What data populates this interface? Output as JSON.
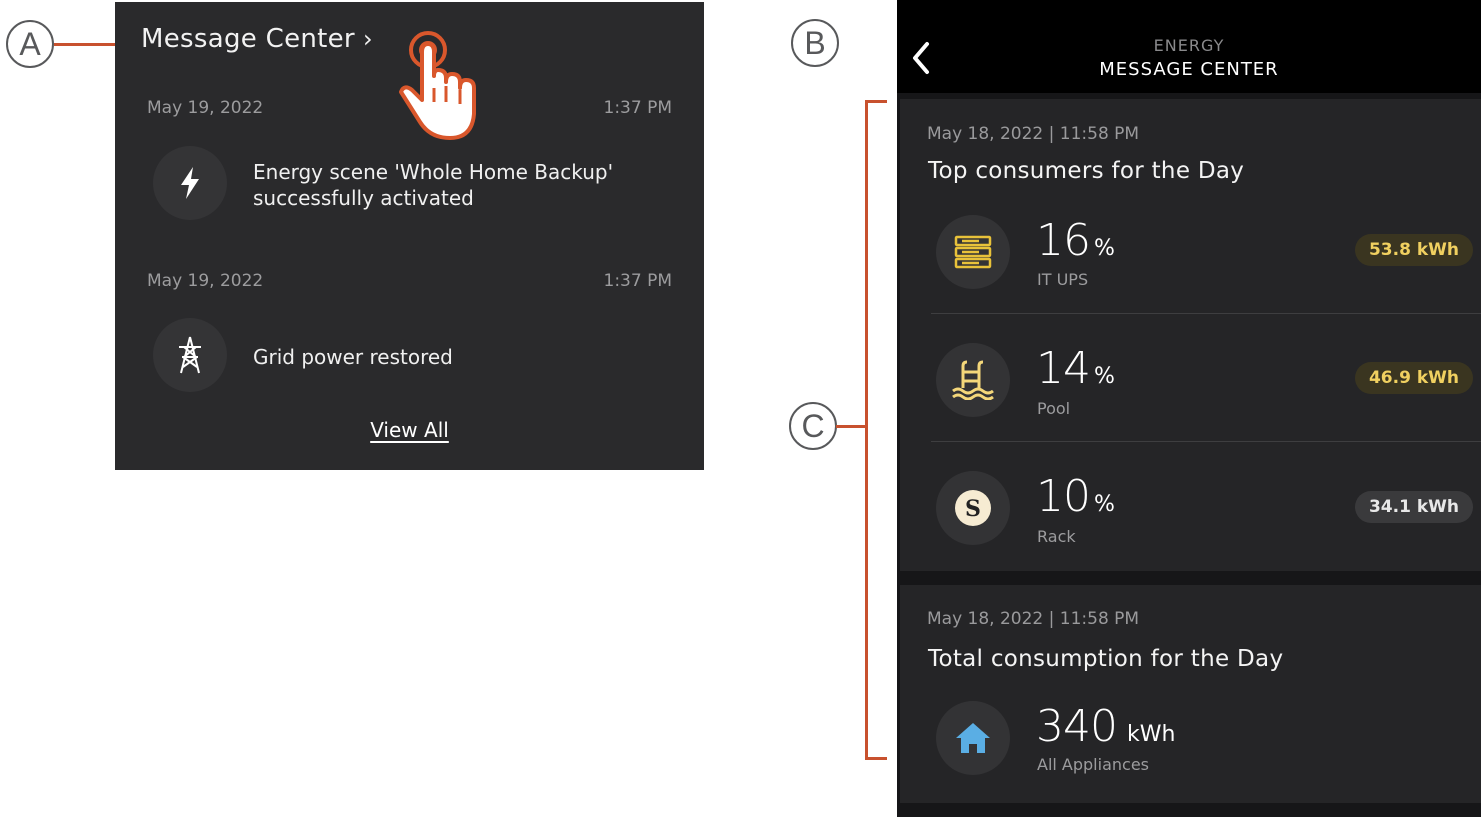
{
  "callouts": {
    "a": "A",
    "b": "B",
    "c": "C"
  },
  "colors": {
    "accent": "#c8512e",
    "badge_yellow_bg": "#3a3520",
    "badge_yellow_text": "#f0d060",
    "badge_gray_bg": "#3a3a3c"
  },
  "panel_a": {
    "title": "Message Center",
    "chevron_icon": "chevron-right-icon",
    "messages": [
      {
        "date": "May 19, 2022",
        "time": "1:37 PM",
        "icon": "lightning-icon",
        "text_line1": "Energy scene 'Whole Home Backup'",
        "text_line2": "successfully activated"
      },
      {
        "date": "May 19, 2022",
        "time": "1:37 PM",
        "icon": "power-tower-icon",
        "text_line1": "Grid power restored"
      }
    ],
    "view_all": "View All"
  },
  "panel_b": {
    "header": {
      "subtitle": "ENERGY",
      "title": "MESSAGE CENTER",
      "back_icon": "chevron-left-icon"
    },
    "cards": [
      {
        "date": "May 18, 2022 | 11:58 PM",
        "title": "Top consumers for the Day",
        "rows": [
          {
            "icon": "server-icon",
            "percent": "16",
            "unit": "%",
            "label": "IT UPS",
            "energy": "53.8 kWh"
          },
          {
            "icon": "pool-icon",
            "percent": "14",
            "unit": "%",
            "label": "Pool",
            "energy": "46.9 kWh"
          },
          {
            "icon": "rack-s-icon",
            "percent": "10",
            "unit": "%",
            "label": "Rack",
            "energy": "34.1 kWh"
          }
        ]
      },
      {
        "date": "May 18, 2022 | 11:58 PM",
        "title": "Total consumption for the Day",
        "total": {
          "icon": "home-icon",
          "value": "340",
          "unit": "kWh",
          "label": "All Appliances"
        }
      }
    ]
  }
}
